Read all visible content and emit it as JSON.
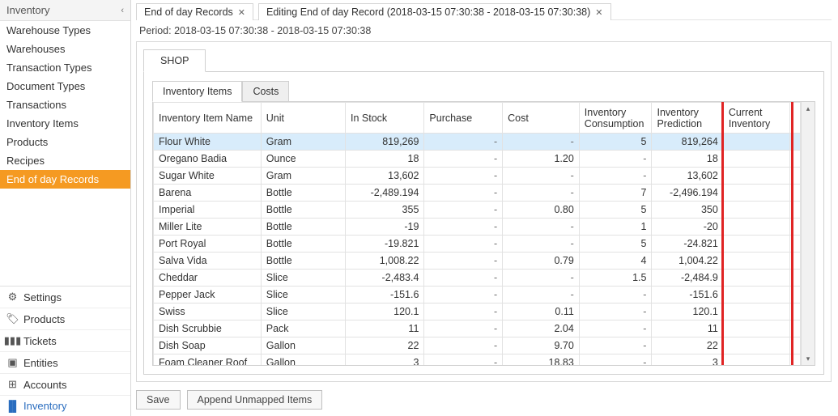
{
  "sidebar": {
    "header": "Inventory",
    "items": [
      {
        "label": "Warehouse Types",
        "active": false
      },
      {
        "label": "Warehouses",
        "active": false
      },
      {
        "label": "Transaction Types",
        "active": false
      },
      {
        "label": "Document Types",
        "active": false
      },
      {
        "label": "Transactions",
        "active": false
      },
      {
        "label": "Inventory Items",
        "active": false
      },
      {
        "label": "Products",
        "active": false
      },
      {
        "label": "Recipes",
        "active": false
      },
      {
        "label": "End of day Records",
        "active": true
      }
    ],
    "footer": [
      {
        "icon": "gear-icon",
        "glyph": "⚙",
        "label": "Settings",
        "active": false
      },
      {
        "icon": "tag-icon",
        "glyph": "🏷",
        "label": "Products",
        "active": false
      },
      {
        "icon": "books-icon",
        "glyph": "▮▮▮",
        "label": "Tickets",
        "active": false
      },
      {
        "icon": "cubes-icon",
        "glyph": "▣",
        "label": "Entities",
        "active": false
      },
      {
        "icon": "calculator-icon",
        "glyph": "⊞",
        "label": "Accounts",
        "active": false
      },
      {
        "icon": "flag-icon",
        "glyph": "▐▌",
        "label": "Inventory",
        "active": true
      }
    ]
  },
  "tabs": [
    {
      "label": "End of day Records"
    },
    {
      "label": "Editing End of day Record (2018-03-15 07:30:38 - 2018-03-15 07:30:38)"
    }
  ],
  "period_label": "Period: 2018-03-15 07:30:38 - 2018-03-15 07:30:38",
  "top_tab": "SHOP",
  "sub_tabs": {
    "items": "Inventory Items",
    "costs": "Costs"
  },
  "columns": {
    "name": "Inventory Item Name",
    "unit": "Unit",
    "stock": "In Stock",
    "purchase": "Purchase",
    "cost": "Cost",
    "cons": "Inventory Consumption",
    "pred": "Inventory Prediction",
    "curr": "Current Inventory"
  },
  "rows": [
    {
      "name": "Flour White",
      "unit": "Gram",
      "stock": "819,269",
      "purchase": "-",
      "cost": "-",
      "cons": "5",
      "pred": "819,264",
      "curr": "",
      "sel": true
    },
    {
      "name": "Oregano Badia",
      "unit": "Ounce",
      "stock": "18",
      "purchase": "-",
      "cost": "1.20",
      "cons": "-",
      "pred": "18",
      "curr": ""
    },
    {
      "name": "Sugar White",
      "unit": "Gram",
      "stock": "13,602",
      "purchase": "-",
      "cost": "-",
      "cons": "-",
      "pred": "13,602",
      "curr": ""
    },
    {
      "name": "Barena",
      "unit": "Bottle",
      "stock": "-2,489.194",
      "purchase": "-",
      "cost": "-",
      "cons": "7",
      "pred": "-2,496.194",
      "curr": ""
    },
    {
      "name": "Imperial",
      "unit": "Bottle",
      "stock": "355",
      "purchase": "-",
      "cost": "0.80",
      "cons": "5",
      "pred": "350",
      "curr": ""
    },
    {
      "name": "Miller Lite",
      "unit": "Bottle",
      "stock": "-19",
      "purchase": "-",
      "cost": "-",
      "cons": "1",
      "pred": "-20",
      "curr": ""
    },
    {
      "name": "Port Royal",
      "unit": "Bottle",
      "stock": "-19.821",
      "purchase": "-",
      "cost": "-",
      "cons": "5",
      "pred": "-24.821",
      "curr": ""
    },
    {
      "name": "Salva Vida",
      "unit": "Bottle",
      "stock": "1,008.22",
      "purchase": "-",
      "cost": "0.79",
      "cons": "4",
      "pred": "1,004.22",
      "curr": ""
    },
    {
      "name": "Cheddar",
      "unit": "Slice",
      "stock": "-2,483.4",
      "purchase": "-",
      "cost": "-",
      "cons": "1.5",
      "pred": "-2,484.9",
      "curr": ""
    },
    {
      "name": "Pepper Jack",
      "unit": "Slice",
      "stock": "-151.6",
      "purchase": "-",
      "cost": "-",
      "cons": "-",
      "pred": "-151.6",
      "curr": ""
    },
    {
      "name": "Swiss",
      "unit": "Slice",
      "stock": "120.1",
      "purchase": "-",
      "cost": "0.11",
      "cons": "-",
      "pred": "120.1",
      "curr": ""
    },
    {
      "name": "Dish Scrubbie",
      "unit": "Pack",
      "stock": "11",
      "purchase": "-",
      "cost": "2.04",
      "cons": "-",
      "pred": "11",
      "curr": ""
    },
    {
      "name": "Dish Soap",
      "unit": "Gallon",
      "stock": "22",
      "purchase": "-",
      "cost": "9.70",
      "cons": "-",
      "pred": "22",
      "curr": ""
    },
    {
      "name": "Foam Cleaner Roof",
      "unit": "Gallon",
      "stock": "3",
      "purchase": "-",
      "cost": "18.83",
      "cons": "-",
      "pred": "3",
      "curr": ""
    }
  ],
  "buttons": {
    "save": "Save",
    "append": "Append Unmapped Items"
  }
}
